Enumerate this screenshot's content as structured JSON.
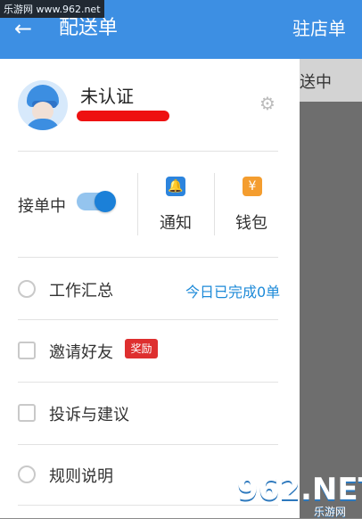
{
  "header": {
    "back_symbol": "←",
    "title": "配送单",
    "right_title": "驻店单"
  },
  "background": {
    "tab_text": "送中"
  },
  "profile": {
    "name": "未认证"
  },
  "status": {
    "accepting_label": "接单中"
  },
  "quick_actions": {
    "notice_label": "通知",
    "wallet_label": "钱包"
  },
  "menu": {
    "items": [
      {
        "label": "工作汇总"
      },
      {
        "label": "邀请好友"
      },
      {
        "label": "投诉与建议"
      },
      {
        "label": "规则说明"
      }
    ],
    "work_summary_status": "今日已完成0单",
    "invite_badge": "奖励"
  },
  "watermarks": {
    "top": "乐游网 www.962.net",
    "bottom_main": "962.NET",
    "bottom_sub": "乐游网"
  },
  "colors": {
    "appbar": "#3d8fe3",
    "accent_blue": "#1d8ad8",
    "badge_red": "#de2f2f",
    "wallet_orange": "#f49d2f"
  },
  "icons": {
    "back": "back-arrow-icon",
    "settings": "gear-icon",
    "notice": "bell-icon",
    "wallet": "wallet-icon",
    "summary": "report-icon",
    "invite": "user-add-icon",
    "feedback": "message-icon",
    "rules": "info-icon"
  }
}
